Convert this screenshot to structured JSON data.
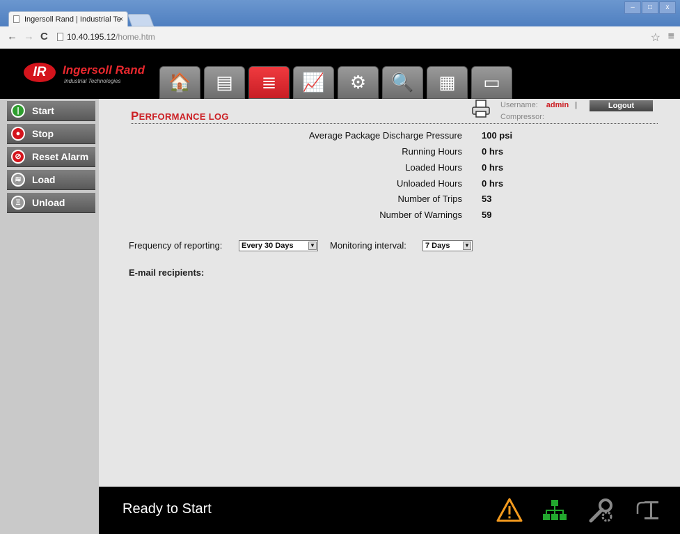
{
  "browser": {
    "tab_title": "Ingersoll Rand | Industrial Te",
    "tab_close": "×",
    "url_host": "10.40.195.12",
    "url_path": "/home.htm",
    "window_buttons": [
      "–",
      "□",
      "x"
    ]
  },
  "logo": {
    "mark": "IR",
    "brand": "Ingersoll Rand",
    "subtitle": "Industrial Technologies"
  },
  "nav_tabs": [
    {
      "icon": "home-icon",
      "glyph": "🏠"
    },
    {
      "icon": "report-icon",
      "glyph": "▤"
    },
    {
      "icon": "performance-log-icon",
      "glyph": "≣",
      "active": true
    },
    {
      "icon": "chart-icon",
      "glyph": "📈"
    },
    {
      "icon": "settings-list-icon",
      "glyph": "⚙"
    },
    {
      "icon": "inspect-icon",
      "glyph": "🔍"
    },
    {
      "icon": "network-card-icon",
      "glyph": "▦"
    },
    {
      "icon": "contact-card-icon",
      "glyph": "▭"
    }
  ],
  "sidebar": {
    "buttons": [
      {
        "label": "Start",
        "icon": "power-icon",
        "color": "#2e9e2e"
      },
      {
        "label": "Stop",
        "icon": "stop-icon",
        "color": "#d4141c"
      },
      {
        "label": "Reset Alarm",
        "icon": "reset-icon",
        "color": "#d4141c"
      },
      {
        "label": "Load",
        "icon": "load-icon",
        "color": "#999999"
      },
      {
        "label": "Unload",
        "icon": "unload-icon",
        "color": "#999999"
      }
    ]
  },
  "page": {
    "title_first": "P",
    "title_rest": "ERFORMANCE LOG",
    "username_label": "Username:",
    "username": "admin",
    "separator": "|",
    "compressor_label": "Compressor:",
    "logout_label": "Logout"
  },
  "stats": [
    {
      "label": "Average Package Discharge Pressure",
      "value": "100 psi"
    },
    {
      "label": "Running Hours",
      "value": "0 hrs"
    },
    {
      "label": "Loaded Hours",
      "value": "0 hrs"
    },
    {
      "label": "Unloaded Hours",
      "value": "0 hrs"
    },
    {
      "label": "Number of Trips",
      "value": "53"
    },
    {
      "label": "Number of Warnings",
      "value": "59"
    }
  ],
  "controls": {
    "frequency_label": "Frequency of reporting:",
    "frequency_value": "Every 30 Days",
    "interval_label": "Monitoring interval:",
    "interval_value": "7 Days",
    "email_label": "E-mail recipients:"
  },
  "status": {
    "text": "Ready to Start",
    "icons": [
      "warning-icon",
      "network-icon",
      "service-icon",
      "unload-status-icon"
    ],
    "colors": {
      "warning": "#f39a1e",
      "network": "#22a82e",
      "inactive": "#888888"
    }
  }
}
